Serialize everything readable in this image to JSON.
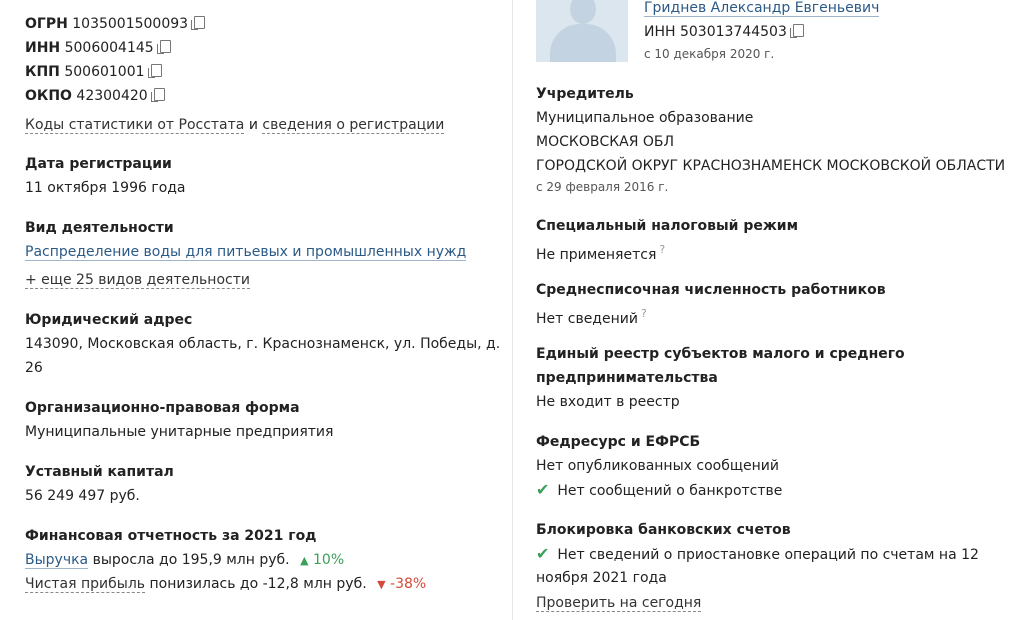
{
  "left": {
    "ogrn": {
      "label": "ОГРН",
      "value": "1035001500093"
    },
    "inn": {
      "label": "ИНН",
      "value": "5006004145"
    },
    "kpp": {
      "label": "КПП",
      "value": "500601001"
    },
    "okpo": {
      "label": "ОКПО",
      "value": "42300420"
    },
    "stat_link": "Коды статистики от Росстата",
    "stat_and": "и",
    "reg_link": "сведения о регистрации",
    "reg_date": {
      "label": "Дата регистрации",
      "value": "11 октября 1996 года"
    },
    "activity": {
      "label": "Вид деятельности",
      "main": "Распределение воды для питьевых и промышленных нужд",
      "more": "+ еще 25 видов деятельности"
    },
    "address": {
      "label": "Юридический адрес",
      "line1": "143090, Московская область, г. Краснознаменск, ул. Победы, д.",
      "line2": "26"
    },
    "org_form": {
      "label": "Организационно-правовая форма",
      "value": "Муниципальные унитарные предприятия"
    },
    "capital": {
      "label": "Уставный капитал",
      "value": "56 249 497 руб."
    },
    "finance": {
      "label": "Финансовая отчетность за 2021 год",
      "revenue_link": "Выручка",
      "revenue_text": "выросла до 195,9 млн руб.",
      "revenue_change": "10%",
      "profit_link": "Чистая прибыль",
      "profit_text": "понизилась до -12,8 млн руб.",
      "profit_change": "-38%"
    }
  },
  "right": {
    "director": {
      "name": "Гриднев Александр Евгеньевич",
      "inn": "ИНН 503013744503",
      "since": "с 10 декабря 2020 г."
    },
    "founder": {
      "label": "Учредитель",
      "line1": "Муниципальное образование",
      "line2": "МОСКОВСКАЯ ОБЛ",
      "line3": "ГОРОДСКОЙ ОКРУГ КРАСНОЗНАМЕНСК МОСКОВСКОЙ ОБЛАСТИ",
      "since": "с 29 февраля 2016 г."
    },
    "tax": {
      "label": "Специальный налоговый режим",
      "value": "Не применяется"
    },
    "staff": {
      "label": "Среднесписочная численность работников",
      "value": "Нет сведений"
    },
    "smb": {
      "label1": "Единый реестр субъектов малого и среднего",
      "label2": "предпринимательства",
      "value": "Не входит в реестр"
    },
    "fedres": {
      "label": "Федресурс и ЕФРСБ",
      "value1": "Нет опубликованных сообщений",
      "value2": "Нет сообщений о банкротстве"
    },
    "blocking": {
      "label": "Блокировка банковских счетов",
      "line1": "Нет сведений о приостановке операций по счетам на 12",
      "line2": "ноября 2021 года",
      "check_link": "Проверить на сегодня"
    }
  },
  "colors": {
    "link": "#2b5a87",
    "positive": "#3aa05a",
    "negative": "#d44a3a"
  },
  "icons": {
    "copy": "copy-icon",
    "help": "help-icon",
    "check": "check-icon",
    "up": "arrow-up-icon",
    "down": "arrow-down-icon"
  }
}
